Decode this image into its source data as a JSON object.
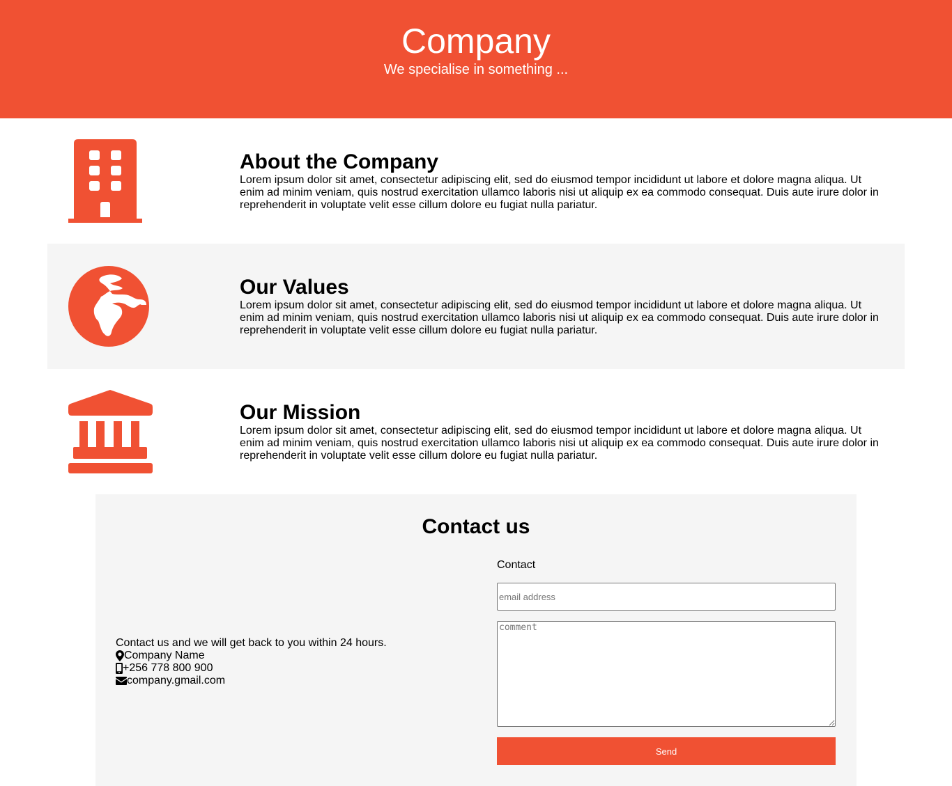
{
  "header": {
    "title": "Company",
    "subtitle": "We specialise in something ..."
  },
  "sections": [
    {
      "icon": "building-icon",
      "title": "About the Company",
      "body": "Lorem ipsum dolor sit amet, consectetur adipiscing elit, sed do eiusmod tempor incididunt ut labore et dolore magna aliqua. Ut enim ad minim veniam, quis nostrud exercitation ullamco laboris nisi ut aliquip ex ea commodo consequat. Duis aute irure dolor in reprehenderit in voluptate velit esse cillum dolore eu fugiat nulla pariatur."
    },
    {
      "icon": "globe-icon",
      "title": "Our Values",
      "body": "Lorem ipsum dolor sit amet, consectetur adipiscing elit, sed do eiusmod tempor incididunt ut labore et dolore magna aliqua. Ut enim ad minim veniam, quis nostrud exercitation ullamco laboris nisi ut aliquip ex ea commodo consequat. Duis aute irure dolor in reprehenderit in voluptate velit esse cillum dolore eu fugiat nulla pariatur."
    },
    {
      "icon": "bank-icon",
      "title": "Our Mission",
      "body": "Lorem ipsum dolor sit amet, consectetur adipiscing elit, sed do eiusmod tempor incididunt ut labore et dolore magna aliqua. Ut enim ad minim veniam, quis nostrud exercitation ullamco laboris nisi ut aliquip ex ea commodo consequat. Duis aute irure dolor in reprehenderit in voluptate velit esse cillum dolore eu fugiat nulla pariatur."
    }
  ],
  "contact": {
    "title": "Contact us",
    "intro": "Contact us and we will get back to you within 24 hours.",
    "company_name": "Company Name",
    "phone": "+256 778 800 900",
    "email": "company.gmail.com",
    "form": {
      "label": "Contact",
      "email_placeholder": "email address",
      "email_value": "",
      "comment_placeholder": "comment",
      "comment_value": "",
      "send_label": "Send"
    }
  },
  "colors": {
    "accent": "#f05133",
    "panel_background": "#f5f5f5",
    "page_background": "#ffffff",
    "text": "#000000"
  }
}
